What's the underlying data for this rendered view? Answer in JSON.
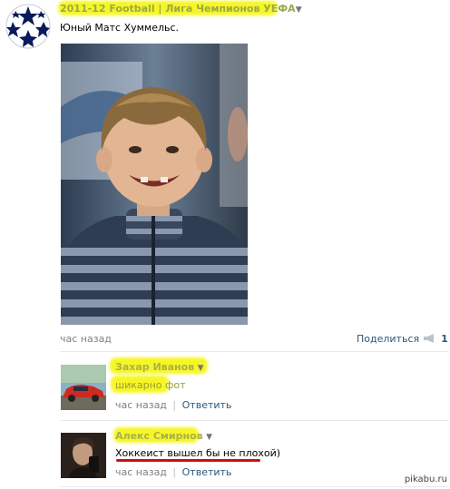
{
  "post": {
    "author": "2011-12 Football | Лига Чемпионов УЕФА",
    "text": "Юный Матс Хуммельс.",
    "time": "час назад",
    "share_label": "Поделиться",
    "share_count": "1",
    "arrow_glyph": "▼"
  },
  "comments": [
    {
      "author": "Захар Иванов",
      "text": "шикарно фот",
      "time": "час назад",
      "reply_label": "Ответить",
      "separator": "|"
    },
    {
      "author": "Алекс Смирнов",
      "text": "Хоккеист вышел бы не плохой)",
      "time": "час назад",
      "reply_label": "Ответить",
      "separator": "|"
    }
  ],
  "watermark": "pikabu.ru",
  "colors": {
    "link": "#2B587A",
    "highlight": "#f6f61a",
    "underline": "#cc1111",
    "divider": "#e7eaed"
  },
  "icons": {
    "avatar": "champions-league-star-ball",
    "share": "megaphone-icon",
    "photo": "boy-portrait-photo"
  }
}
